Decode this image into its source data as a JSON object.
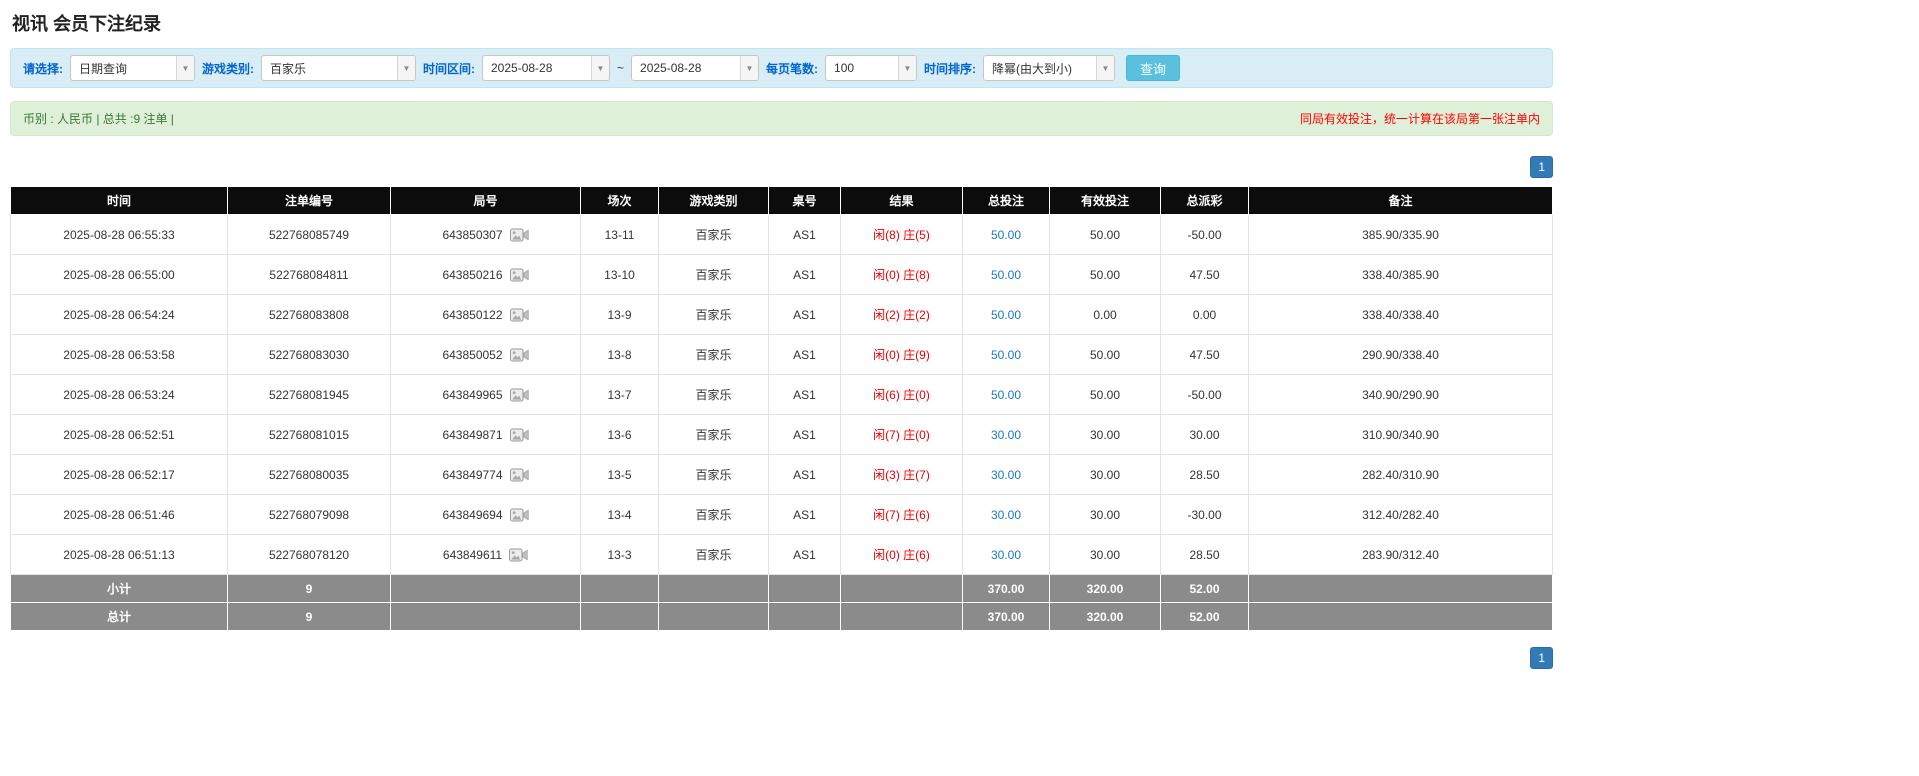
{
  "page": {
    "title": "视讯 会员下注纪录"
  },
  "filters": {
    "select_label": "请选择:",
    "query_type": "日期查询",
    "game_type_label": "游戏类别:",
    "game_type": "百家乐",
    "date_range_label": "时间区间:",
    "date_from": "2025-08-28",
    "date_separator": "~",
    "date_to": "2025-08-28",
    "page_size_label": "每页笔数:",
    "page_size": "100",
    "sort_label": "时间排序:",
    "sort_order": "降幂(由大到小)",
    "search_button": "查询"
  },
  "summary": {
    "left_text": "币别 : 人民币 | 总共 :9 注单 |",
    "right_note": "同局有效投注，统一计算在该局第一张注单内"
  },
  "pagination": {
    "current_page": "1"
  },
  "icons": {
    "chevron_down": "▼"
  },
  "table": {
    "headers": [
      "时间",
      "注单编号",
      "局号",
      "场次",
      "游戏类别",
      "桌号",
      "结果",
      "总投注",
      "有效投注",
      "总派彩",
      "备注"
    ],
    "rows": [
      {
        "time": "2025-08-28 06:55:33",
        "bet_id": "522768085749",
        "round_id": "643850307",
        "session": "13-11",
        "game": "百家乐",
        "table_no": "AS1",
        "result_player": "闲(8)",
        "result_banker": "庄(5)",
        "total_bet": "50.00",
        "valid_bet": "50.00",
        "payout": "-50.00",
        "remark": "385.90/335.90"
      },
      {
        "time": "2025-08-28 06:55:00",
        "bet_id": "522768084811",
        "round_id": "643850216",
        "session": "13-10",
        "game": "百家乐",
        "table_no": "AS1",
        "result_player": "闲(0)",
        "result_banker": "庄(8)",
        "total_bet": "50.00",
        "valid_bet": "50.00",
        "payout": "47.50",
        "remark": "338.40/385.90"
      },
      {
        "time": "2025-08-28 06:54:24",
        "bet_id": "522768083808",
        "round_id": "643850122",
        "session": "13-9",
        "game": "百家乐",
        "table_no": "AS1",
        "result_player": "闲(2)",
        "result_banker": "庄(2)",
        "total_bet": "50.00",
        "valid_bet": "0.00",
        "payout": "0.00",
        "remark": "338.40/338.40"
      },
      {
        "time": "2025-08-28 06:53:58",
        "bet_id": "522768083030",
        "round_id": "643850052",
        "session": "13-8",
        "game": "百家乐",
        "table_no": "AS1",
        "result_player": "闲(0)",
        "result_banker": "庄(9)",
        "total_bet": "50.00",
        "valid_bet": "50.00",
        "payout": "47.50",
        "remark": "290.90/338.40"
      },
      {
        "time": "2025-08-28 06:53:24",
        "bet_id": "522768081945",
        "round_id": "643849965",
        "session": "13-7",
        "game": "百家乐",
        "table_no": "AS1",
        "result_player": "闲(6)",
        "result_banker": "庄(0)",
        "total_bet": "50.00",
        "valid_bet": "50.00",
        "payout": "-50.00",
        "remark": "340.90/290.90"
      },
      {
        "time": "2025-08-28 06:52:51",
        "bet_id": "522768081015",
        "round_id": "643849871",
        "session": "13-6",
        "game": "百家乐",
        "table_no": "AS1",
        "result_player": "闲(7)",
        "result_banker": "庄(0)",
        "total_bet": "30.00",
        "valid_bet": "30.00",
        "payout": "30.00",
        "remark": "310.90/340.90"
      },
      {
        "time": "2025-08-28 06:52:17",
        "bet_id": "522768080035",
        "round_id": "643849774",
        "session": "13-5",
        "game": "百家乐",
        "table_no": "AS1",
        "result_player": "闲(3)",
        "result_banker": "庄(7)",
        "total_bet": "30.00",
        "valid_bet": "30.00",
        "payout": "28.50",
        "remark": "282.40/310.90"
      },
      {
        "time": "2025-08-28 06:51:46",
        "bet_id": "522768079098",
        "round_id": "643849694",
        "session": "13-4",
        "game": "百家乐",
        "table_no": "AS1",
        "result_player": "闲(7)",
        "result_banker": "庄(6)",
        "total_bet": "30.00",
        "valid_bet": "30.00",
        "payout": "-30.00",
        "remark": "312.40/282.40"
      },
      {
        "time": "2025-08-28 06:51:13",
        "bet_id": "522768078120",
        "round_id": "643849611",
        "session": "13-3",
        "game": "百家乐",
        "table_no": "AS1",
        "result_player": "闲(0)",
        "result_banker": "庄(6)",
        "total_bet": "30.00",
        "valid_bet": "30.00",
        "payout": "28.50",
        "remark": "283.90/312.40"
      }
    ],
    "subtotal": {
      "label": "小计",
      "count": "9",
      "total_bet": "370.00",
      "valid_bet": "320.00",
      "payout": "52.00"
    },
    "total": {
      "label": "总计",
      "count": "9",
      "total_bet": "370.00",
      "valid_bet": "320.00",
      "payout": "52.00"
    }
  },
  "colors": {
    "label_blue": "#0066cc",
    "link_blue": "#1a7bc4",
    "negative_red": "#e60000",
    "result_red": "#e60000",
    "note_red": "#ff0000",
    "header_bg": "#0c0c0c",
    "footer_bg": "#8b8b8b",
    "filter_bg": "#d9edf7",
    "summary_bg": "#dff0d8",
    "button_cyan": "#5bc0de",
    "pagination_blue": "#337ab7"
  }
}
